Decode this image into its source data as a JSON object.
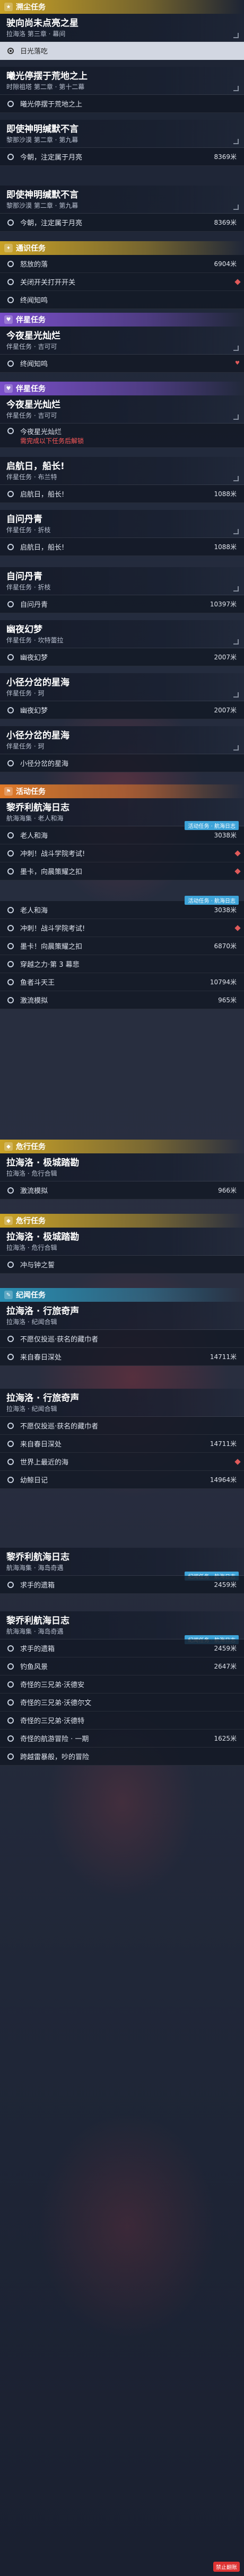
{
  "quests": {
    "q1": {
      "title": "驶向尚未点亮之星",
      "sub": "拉海洛 第三章 · 幕间",
      "header": "溯尘任务",
      "row1": "日光落吃"
    },
    "q2": {
      "title": "曦光停摆于荒地之上",
      "sub": "时隙祖塔 第二章 · 第十二幕",
      "row1": "曦光停摆于荒地之上"
    },
    "q3": {
      "title": "即使神明缄默不言",
      "sub": "黎那沙漠 第二章 · 第九幕",
      "row1": "今朝，注定属于月亮",
      "row1_dist": "8369米"
    },
    "q3b": {
      "title": "即使神明缄默不言",
      "sub": "黎那沙漠 第二章 · 第九幕",
      "row1": "今朝，注定属于月亮",
      "row1_dist": "8369米"
    },
    "routine": {
      "header": "通识任务",
      "rows": [
        {
          "label": "怒放的落",
          "dist": "6904米"
        },
        {
          "label": "关闭开关打开开关",
          "dist": ""
        },
        {
          "label": "终闻知鸣",
          "dist": ""
        }
      ]
    },
    "pair1": {
      "header": "伴星任务",
      "title": "今夜星光灿烂",
      "sub": "伴星任务 · 吉可可",
      "rows": [
        {
          "label": "终闻知鸣",
          "dist": ""
        }
      ]
    },
    "pair2": {
      "header": "伴星任务",
      "title": "今夜星光灿烂",
      "sub": "伴星任务 · 吉可可",
      "rows": [
        {
          "label": "今夜星光灿烂",
          "red": "需完成以下任务后解锁"
        }
      ]
    },
    "pair3": {
      "title": "启航日，船长!",
      "sub": "伴星任务 · 布兰特",
      "rows": [
        {
          "label": "启航日，船长!",
          "dist": "1088米"
        }
      ]
    },
    "pair4": {
      "title": "自问丹青",
      "sub": "伴星任务 · 折枝",
      "rows": [
        {
          "label": "启航日，船长!",
          "dist": "1088米"
        }
      ]
    },
    "pair5": {
      "title": "自问丹青",
      "sub": "伴星任务 · 折枝",
      "rows": [
        {
          "label": "自问丹青",
          "dist": "10397米"
        }
      ]
    },
    "pair6": {
      "title": "幽夜幻梦",
      "sub": "伴星任务 · 坎特蕾拉",
      "rows": [
        {
          "label": "幽夜幻梦",
          "dist": "2007米"
        }
      ]
    },
    "pair7": {
      "title": "小径分岔的星海",
      "sub": "伴星任务 · 珂",
      "rows": [
        {
          "label": "幽夜幻梦",
          "dist": "2007米"
        }
      ]
    },
    "pair8": {
      "title": "小径分岔的星海",
      "sub": "伴星任务 · 珂",
      "rows": [
        {
          "label": "小径分岔的星海",
          "dist": ""
        }
      ]
    },
    "event1": {
      "header": "活动任务",
      "title": "黎乔利航海日志",
      "sub": "航海海集 · 老人和海",
      "tag": "活动任务 · 航海日志",
      "rows": [
        {
          "label": "老人和海",
          "dist": "3038米"
        },
        {
          "label": "冲刺！战斗学院考试!",
          "dist": ""
        },
        {
          "label": "墨卡，向晨策耀之扣",
          "dist": ""
        }
      ]
    },
    "event2": {
      "tag": "活动任务 · 航海日志",
      "rows": [
        {
          "label": "老人和海",
          "dist": "3038米"
        },
        {
          "label": "冲刺！战斗学院考试!",
          "dist": ""
        },
        {
          "label": "墨卡！向晨策耀之扣",
          "dist": "6870米"
        },
        {
          "label": "穿越之力·第 3 幕悲",
          "dist": ""
        },
        {
          "label": "鱼者斗天王",
          "dist": "10794米"
        },
        {
          "label": "激流模拟",
          "dist": "965米"
        }
      ]
    },
    "explore1": {
      "header": "危行任务",
      "title": "拉海洛 · 极城踏勘",
      "sub": "拉海洛 · 危行合辑",
      "rows": [
        {
          "label": "激流模拟",
          "dist": "966米"
        }
      ]
    },
    "explore2": {
      "header": "危行任务",
      "title": "拉海洛 · 极城踏勘",
      "sub": "拉海洛 · 危行合辑",
      "rows": [
        {
          "label": "冲与钟之誓",
          "dist": ""
        }
      ]
    },
    "record1": {
      "header": "纪闻任务",
      "title": "拉海洛 · 行旅奇声",
      "sub": "拉海洛 · 纪闻合辑",
      "rows": [
        {
          "label": "不愿仅投巡·获名的藏巾者",
          "dist": ""
        },
        {
          "label": "来自春日深处",
          "dist": "14711米"
        }
      ]
    },
    "record2": {
      "title": "拉海洛 · 行旅奇声",
      "sub": "拉海洛 · 纪闻合辑",
      "rows": [
        {
          "label": "不愿仅投巡·获名的藏巾者",
          "dist": ""
        },
        {
          "label": "来自春日深处",
          "dist": "14711米"
        },
        {
          "label": "世界上最近的海",
          "dist": ""
        },
        {
          "label": "幼鲸日记",
          "dist": "14964米"
        }
      ]
    },
    "record3": {
      "title": "黎乔利航海日志",
      "sub": "航海海集 · 海岛奇遇",
      "tag": "纪闻任务 · 航海日志",
      "rows": [
        {
          "label": "求手的遗箱",
          "dist": "2459米"
        }
      ]
    },
    "record4": {
      "title": "黎乔利航海日志",
      "sub": "航海海集 · 海岛奇遇",
      "tag": "纪闻任务 · 航海日志",
      "rows": [
        {
          "label": "求手的遗箱",
          "dist": "2459米"
        },
        {
          "label": "钓鱼风景",
          "dist": "2647米"
        },
        {
          "label": "奇怪的三兄弟·沃德安",
          "dist": ""
        },
        {
          "label": "奇怪的三兄弟·沃德尔文",
          "dist": ""
        },
        {
          "label": "奇怪的三兄弟·沃德特",
          "dist": ""
        },
        {
          "label": "奇怪的航游冒险 · 一期",
          "dist": "1625米"
        },
        {
          "label": "跨越雷暴般，吵的冒险",
          "dist": ""
        }
      ]
    },
    "footer_badge": "禁止翻账"
  }
}
